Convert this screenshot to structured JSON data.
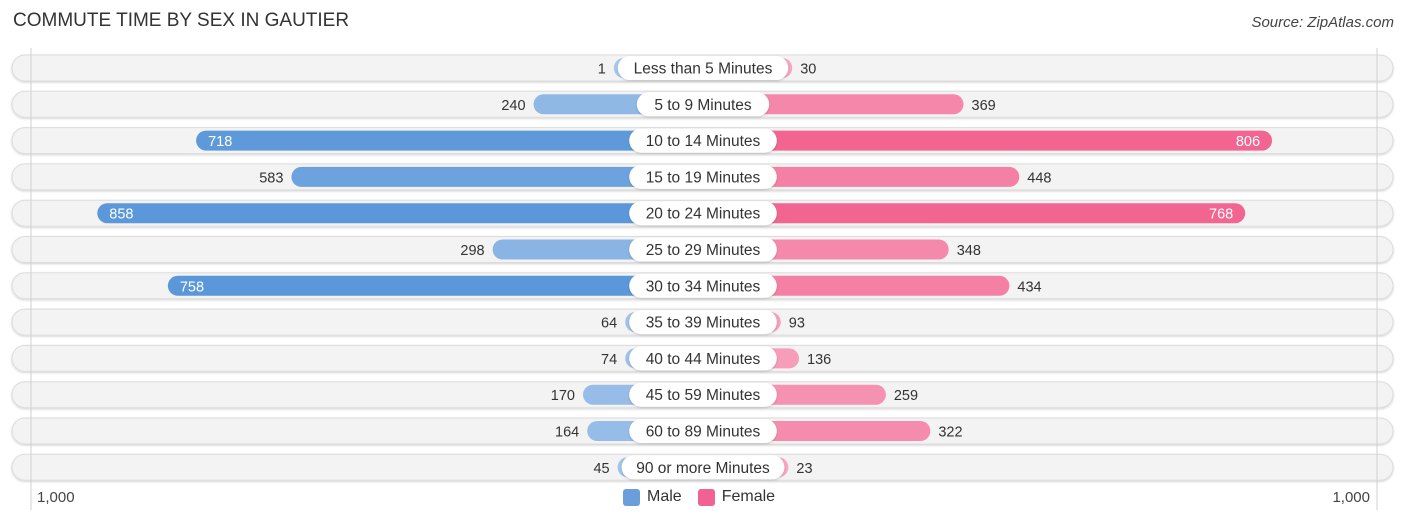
{
  "title": "COMMUTE TIME BY SEX IN GAUTIER",
  "source": "Source: ZipAtlas.com",
  "axis": {
    "left_label": "1,000",
    "right_label": "1,000"
  },
  "legend": [
    {
      "name": "Male",
      "color": "#6a9fdb"
    },
    {
      "name": "Female",
      "color": "#f06292"
    }
  ],
  "colors": {
    "male_strong": "#5b98d9",
    "male_light": "#a7c7eb",
    "female_strong": "#f26591",
    "female_light": "#f7a9c2",
    "row_bg": "#f3f3f3"
  },
  "chart_data": {
    "type": "bar",
    "orientation": "horizontal-diverging",
    "title": "COMMUTE TIME BY SEX IN GAUTIER",
    "categories": [
      "Less than 5 Minutes",
      "5 to 9 Minutes",
      "10 to 14 Minutes",
      "15 to 19 Minutes",
      "20 to 24 Minutes",
      "25 to 29 Minutes",
      "30 to 34 Minutes",
      "35 to 39 Minutes",
      "40 to 44 Minutes",
      "45 to 59 Minutes",
      "60 to 89 Minutes",
      "90 or more Minutes"
    ],
    "series": [
      {
        "name": "Male",
        "values": [
          1,
          240,
          718,
          583,
          858,
          298,
          758,
          64,
          74,
          170,
          164,
          45
        ]
      },
      {
        "name": "Female",
        "values": [
          30,
          369,
          806,
          448,
          768,
          348,
          434,
          93,
          136,
          259,
          322,
          23
        ]
      }
    ],
    "xlim": [
      -1000,
      1000
    ],
    "xlabel": "",
    "ylabel": "",
    "tick_labels": [
      "1,000",
      "1,000"
    ],
    "legend_position": "bottom-center",
    "grid": false
  }
}
